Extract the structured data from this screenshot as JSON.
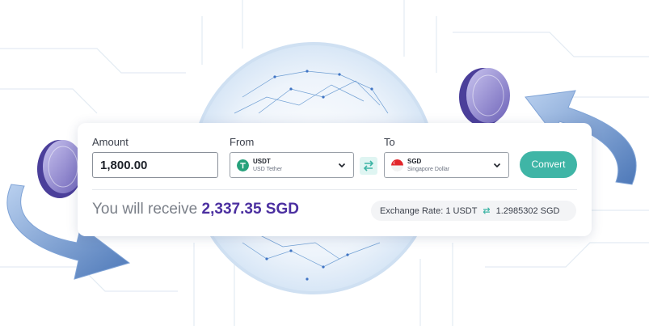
{
  "converter": {
    "amount_label": "Amount",
    "amount_value": "1,800.00",
    "from_label": "From",
    "from": {
      "code": "USDT",
      "name": "USD Tether",
      "icon": "tether-icon",
      "color": "#26a17b"
    },
    "to_label": "To",
    "to": {
      "code": "SGD",
      "name": "Singapore Dollar",
      "icon": "singapore-flag-icon",
      "color": "#e2262b"
    },
    "swap_icon": "swap-arrows-icon",
    "convert_label": "Convert",
    "receive_prefix": "You will receive",
    "receive_amount": "2,337.35 SGD",
    "rate_label": "Exchange Rate:",
    "rate_from": "1 USDT",
    "rate_to": "1.2985302 SGD"
  },
  "colors": {
    "accent": "#3fb5a6",
    "highlight": "#4b2fa0"
  }
}
